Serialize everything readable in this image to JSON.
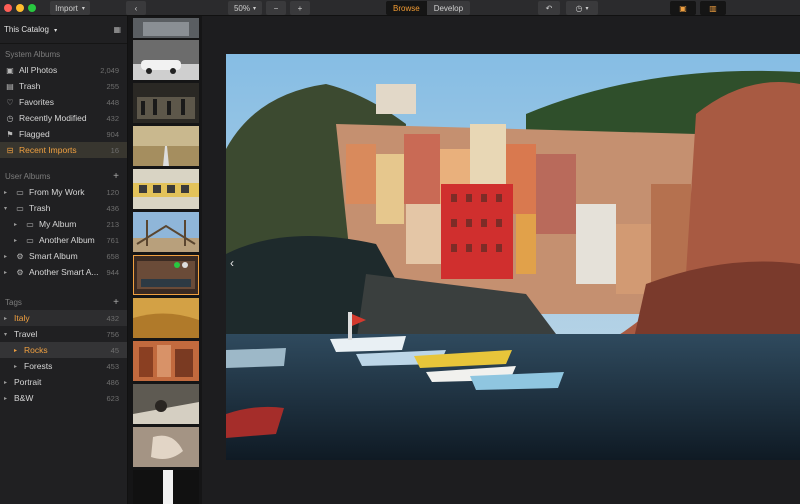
{
  "toolbar": {
    "import_label": "Import",
    "zoom": "50%",
    "browse_label": "Browse",
    "develop_label": "Develop"
  },
  "sidebar": {
    "catalog": "This Catalog",
    "system_albums_title": "System Albums",
    "system_albums": [
      {
        "label": "All Photos",
        "count": "2,049"
      },
      {
        "label": "Trash",
        "count": "255"
      },
      {
        "label": "Favorites",
        "count": "448"
      },
      {
        "label": "Recently Modified",
        "count": "432"
      },
      {
        "label": "Flagged",
        "count": "904"
      },
      {
        "label": "Recent Imports",
        "count": "16"
      }
    ],
    "user_albums_title": "User Albums",
    "user_albums": [
      {
        "label": "From My Work",
        "count": "120"
      },
      {
        "label": "Trash",
        "count": "436"
      },
      {
        "label": "My Album",
        "count": "213"
      },
      {
        "label": "Another Album",
        "count": "761"
      },
      {
        "label": "Smart Album",
        "count": "658"
      },
      {
        "label": "Another Smart A...",
        "count": "944"
      }
    ],
    "tags_title": "Tags",
    "tags": [
      {
        "label": "Italy",
        "count": "432"
      },
      {
        "label": "Travel",
        "count": "756"
      },
      {
        "label": "Rocks",
        "count": "45"
      },
      {
        "label": "Forests",
        "count": "453"
      },
      {
        "label": "Portrait",
        "count": "486"
      },
      {
        "label": "B&W",
        "count": "623"
      }
    ]
  },
  "icons": {
    "add": "plus-icon",
    "arrow_left": "chevron-left-icon"
  },
  "colors": {
    "accent": "#f0a040",
    "background": "#1b1b1d"
  }
}
